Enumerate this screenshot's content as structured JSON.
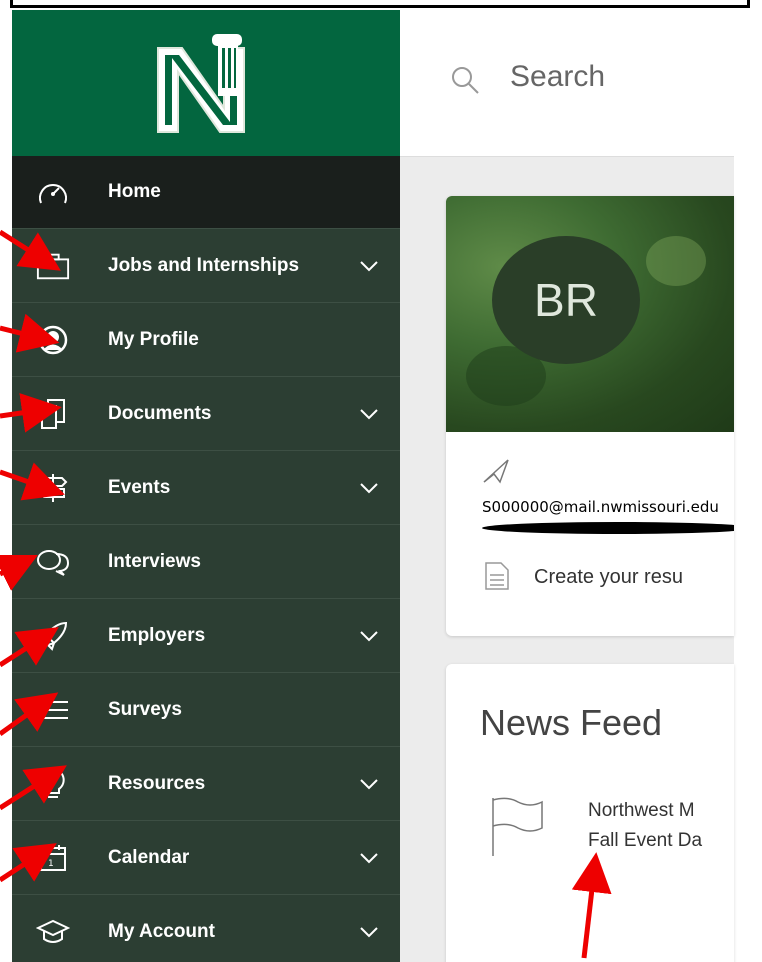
{
  "sidebar": {
    "items": [
      {
        "label": "Home",
        "icon": "dashboard-icon",
        "chevron": false,
        "active": true
      },
      {
        "label": "Jobs and Internships",
        "icon": "briefcase-icon",
        "chevron": true,
        "active": false
      },
      {
        "label": "My Profile",
        "icon": "profile-icon",
        "chevron": false,
        "active": false
      },
      {
        "label": "Documents",
        "icon": "documents-icon",
        "chevron": true,
        "active": false
      },
      {
        "label": "Events",
        "icon": "signpost-icon",
        "chevron": true,
        "active": false
      },
      {
        "label": "Interviews",
        "icon": "chat-bubbles-icon",
        "chevron": false,
        "active": false
      },
      {
        "label": "Employers",
        "icon": "rocket-icon",
        "chevron": true,
        "active": false
      },
      {
        "label": "Surveys",
        "icon": "list-icon",
        "chevron": false,
        "active": false
      },
      {
        "label": "Resources",
        "icon": "lightbulb-icon",
        "chevron": true,
        "active": false
      },
      {
        "label": "Calendar",
        "icon": "calendar-icon",
        "chevron": true,
        "active": false
      },
      {
        "label": "My Account",
        "icon": "graduation-cap-icon",
        "chevron": true,
        "active": false
      }
    ]
  },
  "search": {
    "placeholder": "Search"
  },
  "profile": {
    "initials": "BR",
    "email": "S000000@mail.nwmissouri.edu",
    "create_resume": "Create your resu"
  },
  "news": {
    "title": "News Feed",
    "line1": "Northwest M",
    "line2": "Fall Event Da"
  },
  "colors": {
    "brand_green": "#03663f",
    "sidebar_bg": "#2c3e33",
    "active_bg": "#1a1f1c",
    "annotation_red": "#ee0000"
  }
}
